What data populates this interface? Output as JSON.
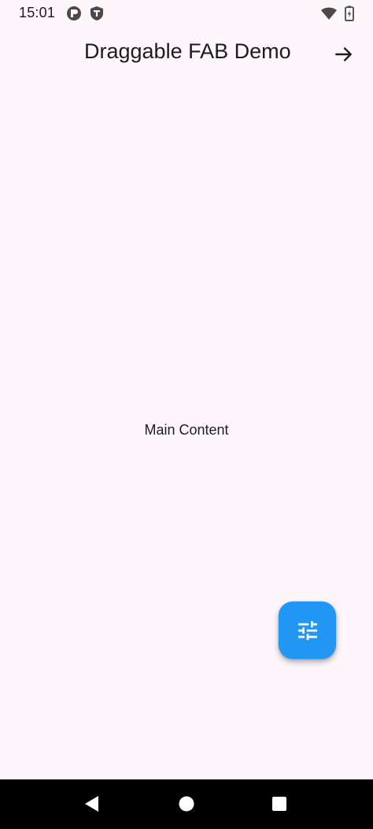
{
  "status_bar": {
    "time": "15:01",
    "left_icons": [
      "app-notification-icon",
      "shield-notification-icon"
    ],
    "right_icons": [
      "wifi-icon",
      "battery-icon"
    ]
  },
  "app_bar": {
    "title": "Draggable FAB Demo",
    "action_icon": "arrow-forward-icon"
  },
  "main": {
    "label": "Main Content"
  },
  "fab": {
    "icon": "tune-icon",
    "color": "#2196f3"
  },
  "navigation_bar": {
    "buttons": [
      "back-icon",
      "home-icon",
      "recents-icon"
    ]
  },
  "colors": {
    "background": "#fdf7fc",
    "text": "#1d1b20",
    "accent": "#2196f3",
    "nav_bar": "#000000"
  }
}
